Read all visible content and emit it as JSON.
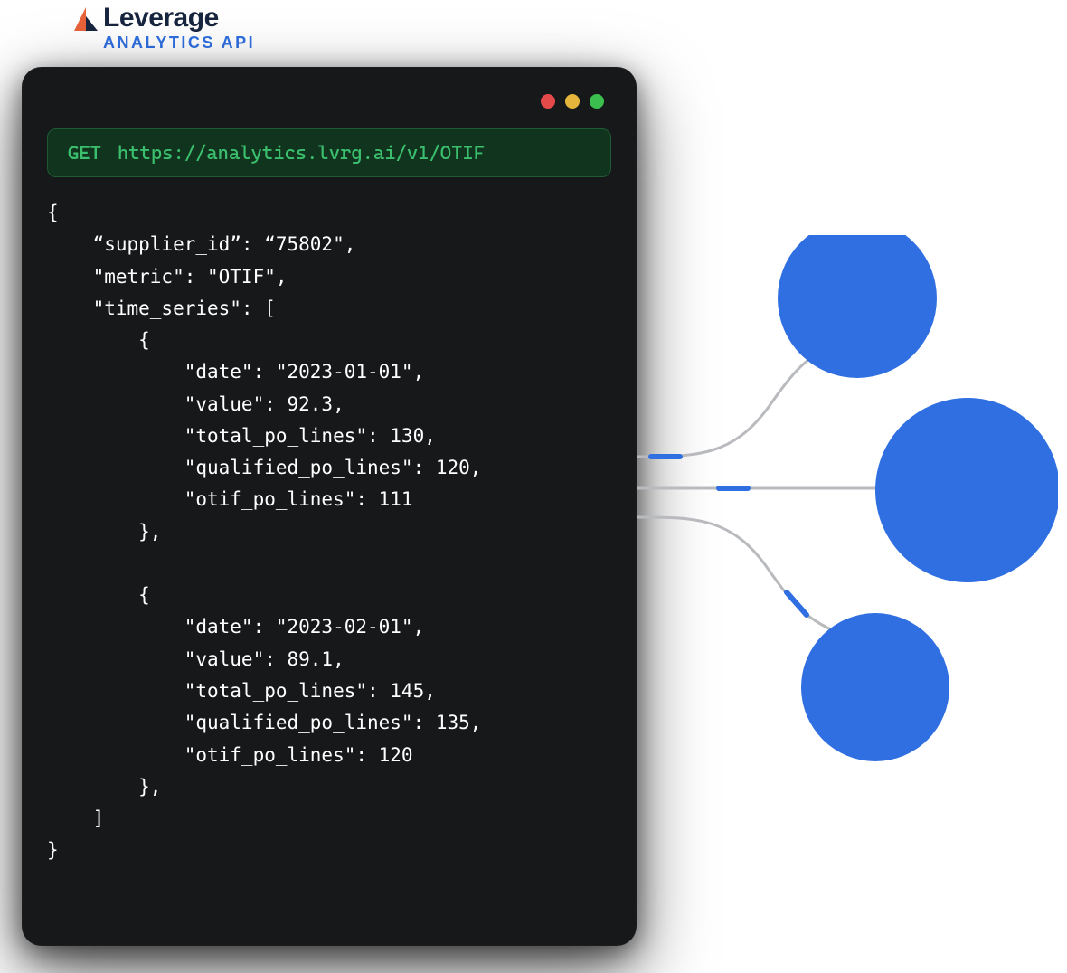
{
  "brand": {
    "name": "Leverage",
    "subtitle": "ANALYTICS API"
  },
  "request": {
    "method": "GET",
    "url": "https://analytics.lvrg.ai/v1/OTIF"
  },
  "response_text": "{\n    “supplier_id”: “75802\",\n    \"metric\": \"OTIF\",\n    \"time_series\": [\n        {\n            \"date\": \"2023-01-01\",\n            \"value\": 92.3,\n            \"total_po_lines\": 130,\n            \"qualified_po_lines\": 120,\n            \"otif_po_lines\": 111\n        },\n\n        {\n            \"date\": \"2023-02-01\",\n            \"value\": 89.1,\n            \"total_po_lines\": 145,\n            \"qualified_po_lines\": 135,\n            \"otif_po_lines\": 120\n        },\n    ]\n}",
  "response": {
    "supplier_id": "75802",
    "metric": "OTIF",
    "time_series": [
      {
        "date": "2023-01-01",
        "value": 92.3,
        "total_po_lines": 130,
        "qualified_po_lines": 120,
        "otif_po_lines": 111
      },
      {
        "date": "2023-02-01",
        "value": 89.1,
        "total_po_lines": 145,
        "qualified_po_lines": 135,
        "otif_po_lines": 120
      }
    ]
  },
  "colors": {
    "accent": "#2f6fe1",
    "terminal_bg": "#17181a",
    "urlbar_bg": "#10341d",
    "method_fg": "#3bbf6e"
  }
}
